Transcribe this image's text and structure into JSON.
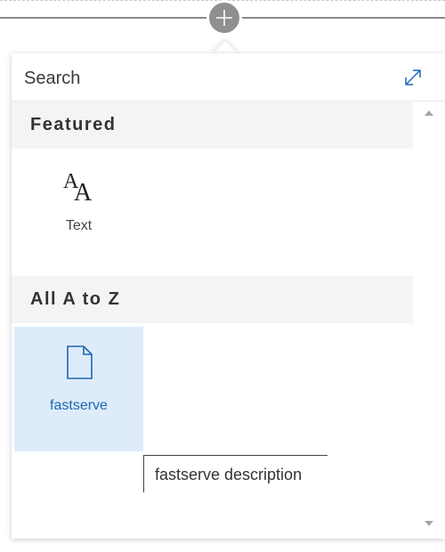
{
  "toolbox": {
    "add_icon": "plus-icon",
    "search": {
      "placeholder": "Search",
      "value": ""
    },
    "expand_icon": "expand-icon",
    "sections": [
      {
        "title": "Featured",
        "items": [
          {
            "label": "Text",
            "icon": "text-icon",
            "selected": false
          }
        ]
      },
      {
        "title": "All A to Z",
        "items": [
          {
            "label": "fastserve",
            "icon": "document-icon",
            "selected": true
          }
        ]
      }
    ],
    "tooltip": "fastserve description"
  },
  "colors": {
    "accent": "#1d67b5",
    "selected_background": "#deecf9",
    "section_background": "#f4f4f4",
    "add_button": "#8f8f8f"
  }
}
